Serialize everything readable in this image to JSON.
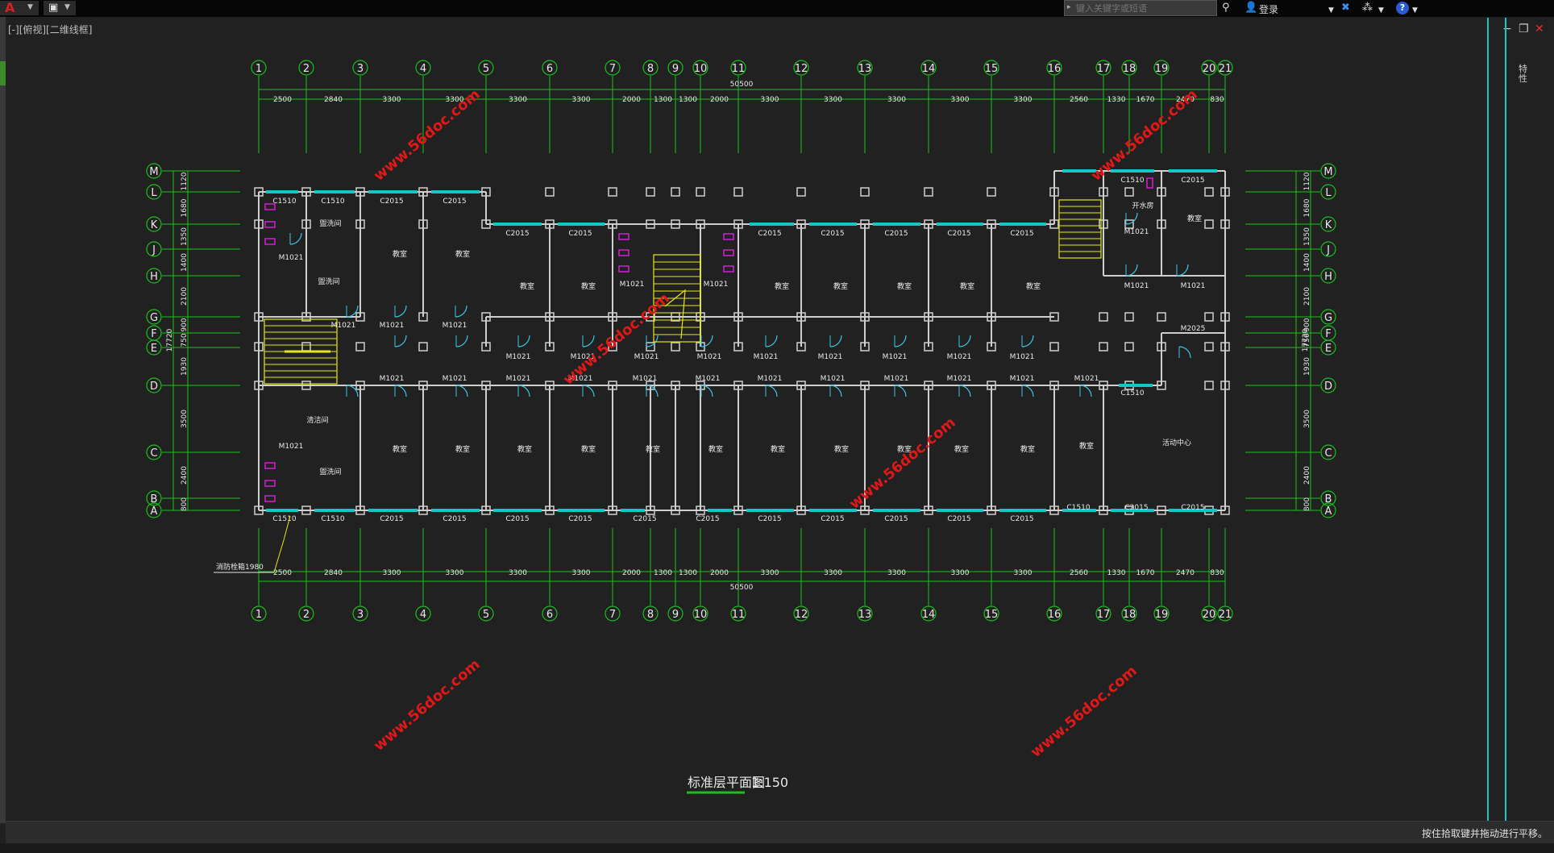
{
  "titlebar": {
    "search_placeholder": "键入关键字或短语",
    "login_label": "登录",
    "icons": [
      "autocad-logo-icon",
      "save-icon",
      "binoculars-icon",
      "user-icon",
      "exchange-x-icon",
      "network-icon",
      "help-icon"
    ]
  },
  "viewport_label": "[-][俯视][二维线框]",
  "side_panel_title": "特性",
  "status_text": "按住拾取键并拖动进行平移。",
  "drawing": {
    "title": "标准层平面图",
    "scale": "1:150",
    "columns": [
      "1",
      "2",
      "3",
      "4",
      "5",
      "6",
      "7",
      "8",
      "9",
      "10",
      "11",
      "12",
      "13",
      "14",
      "15",
      "16",
      "17",
      "18",
      "19",
      "20",
      "21"
    ],
    "rows": [
      "M",
      "L",
      "K",
      "J",
      "H",
      "G",
      "F",
      "E",
      "D",
      "C",
      "B",
      "A"
    ],
    "top_dimensions": [
      "2500",
      "2840",
      "3300",
      "3300",
      "3300",
      "3300",
      "2000",
      "1300",
      "1300",
      "2000",
      "3300",
      "3300",
      "3300",
      "3300",
      "3300",
      "2560",
      "1330",
      "1670",
      "2470",
      "830"
    ],
    "bottom_dimensions": [
      "2500",
      "2840",
      "3300",
      "3300",
      "3300",
      "3300",
      "2000",
      "1300",
      "1300",
      "2000",
      "3300",
      "3300",
      "3300",
      "3300",
      "3300",
      "2560",
      "1330",
      "1670",
      "2470",
      "830"
    ],
    "total_dimension": "50500",
    "left_dimensions": [
      "1120",
      "1680",
      "1350",
      "1400",
      "2100",
      "900",
      "750",
      "1930",
      "3500",
      "2400",
      "800"
    ],
    "right_dimensions": [
      "1120",
      "1680",
      "1350",
      "1400",
      "2100",
      "900",
      "750",
      "1930",
      "3500",
      "2400",
      "800"
    ],
    "side_total": "17720",
    "rooms": {
      "classroom": "教室",
      "washroom": "盥洗间",
      "water_room": "开水房",
      "activity": "活动中心",
      "janitor": "清洁间"
    },
    "window_tags": [
      "C1510",
      "C2015"
    ],
    "door_tags": [
      "M1021",
      "M2025"
    ],
    "annotation": "消防栓箱1980",
    "watermark": "www.56doc.com"
  },
  "colors": {
    "grid": "#19c219",
    "wall": "#cfcfcf",
    "window": "#16c6c6",
    "stair": "#e6e61a",
    "fixture": "#d21ed2",
    "door": "#3ac6e6",
    "watermark": "#e01818"
  }
}
